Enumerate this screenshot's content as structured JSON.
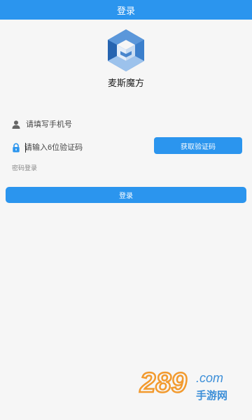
{
  "header": {
    "title": "登录"
  },
  "brand": {
    "app_name": "麦斯魔方",
    "logo": "cube-logo-icon"
  },
  "form": {
    "phone_placeholder": "请填写手机号",
    "code_placeholder": "请输入6位验证码",
    "get_code_label": "获取验证码",
    "password_login_label": "密码登录",
    "login_label": "登录"
  },
  "watermark": {
    "number_text": "289",
    "domain_text": ".com",
    "site_text": "手游网"
  },
  "colors": {
    "accent": "#2b95ee",
    "background": "#f6f6f6",
    "watermark_orange": "#f29a2e",
    "watermark_blue": "#3d8fd8"
  }
}
